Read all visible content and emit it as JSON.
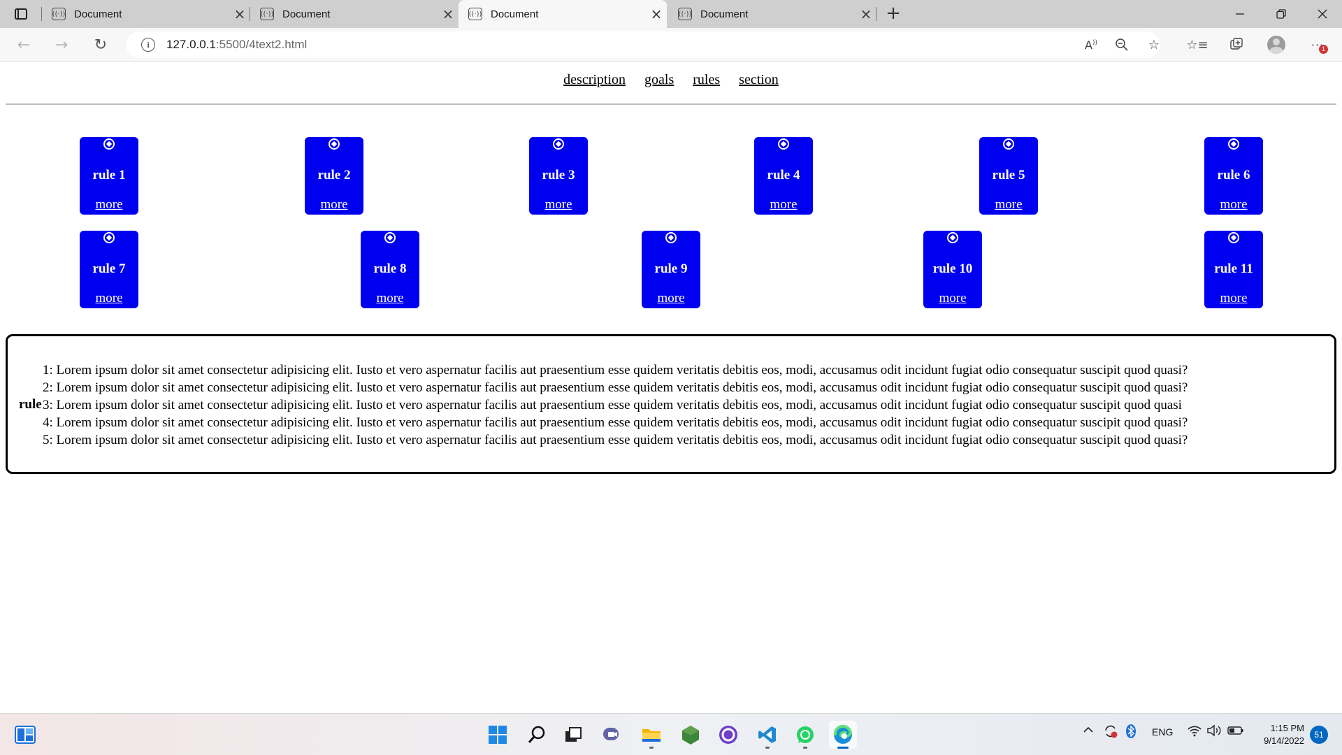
{
  "browser": {
    "tabs": [
      {
        "title": "Document",
        "active": false
      },
      {
        "title": "Document",
        "active": false
      },
      {
        "title": "Document",
        "active": true
      },
      {
        "title": "Document",
        "active": false
      }
    ],
    "address": {
      "host": "127.0.0.1",
      "path": ":5500/4text2.html"
    },
    "notification_badge": "1"
  },
  "page": {
    "nav": [
      "description",
      "goals",
      "rules",
      "section"
    ],
    "cards_row1": [
      {
        "name": "rule 1",
        "link": "more"
      },
      {
        "name": "rule 2",
        "link": "more"
      },
      {
        "name": "rule 3",
        "link": "more"
      },
      {
        "name": "rule 4",
        "link": "more"
      },
      {
        "name": "rule 5",
        "link": "more"
      },
      {
        "name": "rule 6",
        "link": "more"
      }
    ],
    "cards_row2": [
      {
        "name": "rule 7",
        "link": "more"
      },
      {
        "name": "rule 8",
        "link": "more"
      },
      {
        "name": "rule 9",
        "link": "more"
      },
      {
        "name": "rule 10",
        "link": "more"
      },
      {
        "name": "rule 11",
        "link": "more"
      }
    ],
    "rules_label": "rule",
    "rules_list": [
      "1: Lorem ipsum dolor sit amet consectetur adipisicing elit. Iusto et vero aspernatur facilis aut praesentium esse quidem veritatis debitis eos, modi, accusamus odit incidunt fugiat odio consequatur suscipit quod quasi?",
      "2: Lorem ipsum dolor sit amet consectetur adipisicing elit. Iusto et vero aspernatur facilis aut praesentium esse quidem veritatis debitis eos, modi, accusamus odit incidunt fugiat odio consequatur suscipit quod quasi?",
      "3: Lorem ipsum dolor sit amet consectetur adipisicing elit. Iusto et vero aspernatur facilis aut praesentium esse quidem veritatis debitis eos, modi, accusamus odit incidunt fugiat odio consequatur suscipit quod quasi",
      "4: Lorem ipsum dolor sit amet consectetur adipisicing elit. Iusto et vero aspernatur facilis aut praesentium esse quidem veritatis debitis eos, modi, accusamus odit incidunt fugiat odio consequatur suscipit quod quasi?",
      "5: Lorem ipsum dolor sit amet consectetur adipisicing elit. Iusto et vero aspernatur facilis aut praesentium esse quidem veritatis debitis eos, modi, accusamus odit incidunt fugiat odio consequatur suscipit quod quasi?"
    ]
  },
  "taskbar": {
    "apps": [
      "start-icon",
      "search-icon",
      "task-view-icon",
      "teams-chat-icon",
      "file-explorer-icon",
      "nodejs-icon",
      "github-desktop-icon",
      "vscode-icon",
      "whatsapp-icon",
      "edge-icon"
    ],
    "language": "ENG",
    "time": "1:15 PM",
    "date": "9/14/2022",
    "notifications": "51"
  }
}
